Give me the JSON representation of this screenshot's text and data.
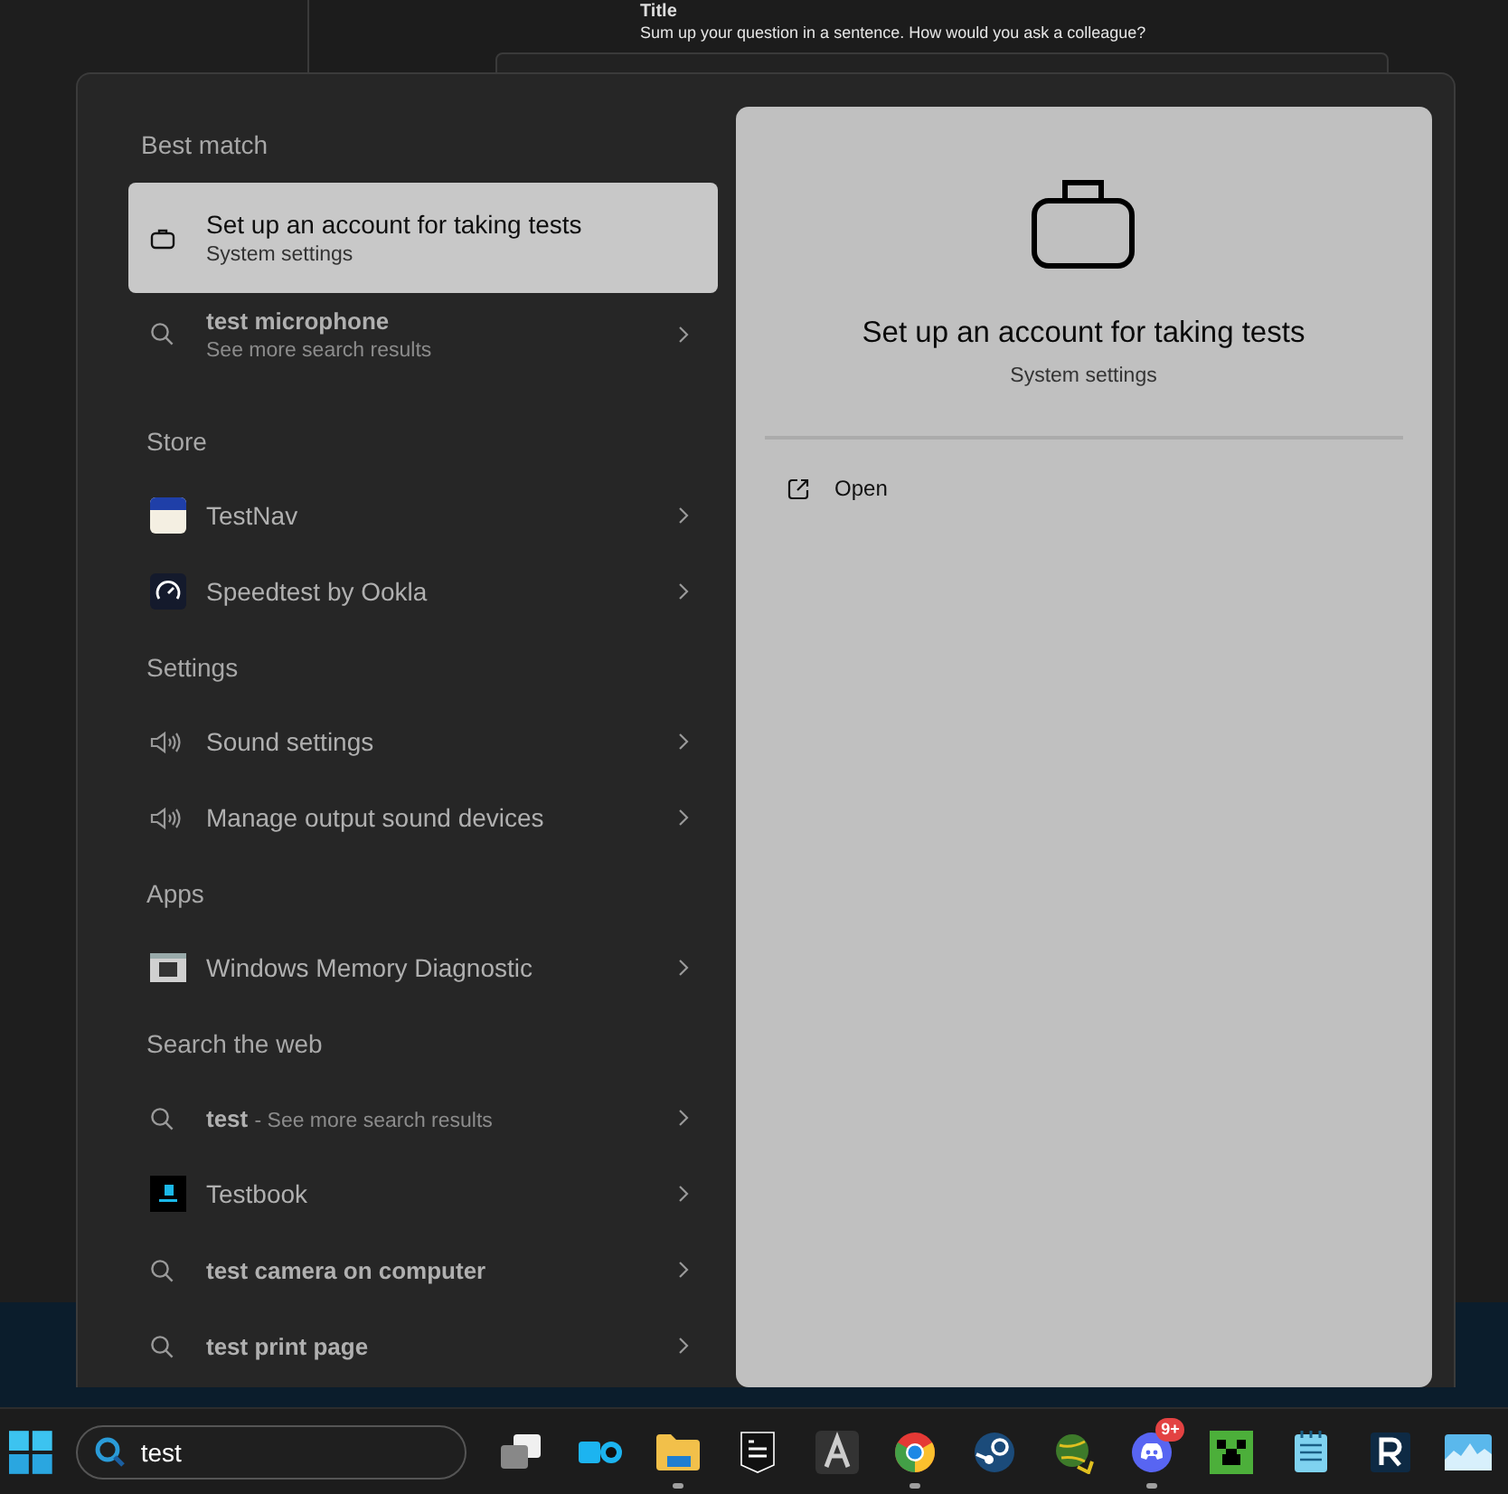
{
  "background_window": {
    "heading": "Title",
    "hint": "Sum up your question in a sentence. How would you ask a colleague?"
  },
  "search_panel": {
    "sections": [
      {
        "title": "Best match",
        "items": [
          {
            "kind": "briefcase",
            "title": "Set up an account for taking tests",
            "subtitle": "System settings",
            "selected": true
          }
        ]
      },
      {
        "items": [
          {
            "kind": "search",
            "title": "test microphone",
            "subtitle": "See more search results",
            "selected": false
          }
        ]
      },
      {
        "title": "Store",
        "items": [
          {
            "kind": "testnav",
            "title": "TestNav",
            "selected": false
          },
          {
            "kind": "speedtest",
            "title": "Speedtest by Ookla",
            "selected": false
          }
        ]
      },
      {
        "title": "Settings",
        "items": [
          {
            "kind": "sound",
            "title": "Sound settings",
            "selected": false
          },
          {
            "kind": "sound",
            "title": "Manage output sound devices",
            "selected": false
          }
        ]
      },
      {
        "title": "Apps",
        "items": [
          {
            "kind": "memory",
            "title": "Windows Memory Diagnostic",
            "selected": false
          }
        ]
      },
      {
        "title": "Search the web",
        "items": [
          {
            "kind": "search",
            "title": "test",
            "inline_note": "- See more search results",
            "selected": false
          },
          {
            "kind": "testbook",
            "title": "Testbook",
            "selected": false
          },
          {
            "kind": "search",
            "title": "test camera on computer",
            "selected": false
          },
          {
            "kind": "search",
            "title": "test print page",
            "selected": false
          }
        ]
      }
    ],
    "preview": {
      "title": "Set up an account for taking tests",
      "subtitle": "System settings",
      "actions": [
        {
          "label": "Open"
        }
      ]
    }
  },
  "taskbar": {
    "search": {
      "value": "test"
    },
    "apps": [
      {
        "kind": "taskview",
        "running": false
      },
      {
        "kind": "dolby",
        "running": false
      },
      {
        "kind": "folder",
        "running": true
      },
      {
        "kind": "epic",
        "running": false
      },
      {
        "kind": "a",
        "running": false
      },
      {
        "kind": "chrome",
        "running": true
      },
      {
        "kind": "steam",
        "running": false
      },
      {
        "kind": "globe",
        "running": false
      },
      {
        "kind": "discord",
        "running": true,
        "badge": "9+"
      },
      {
        "kind": "creeper",
        "running": false
      },
      {
        "kind": "notepad",
        "running": false
      },
      {
        "kind": "r",
        "running": false
      },
      {
        "kind": "monitor",
        "running": false
      }
    ]
  }
}
